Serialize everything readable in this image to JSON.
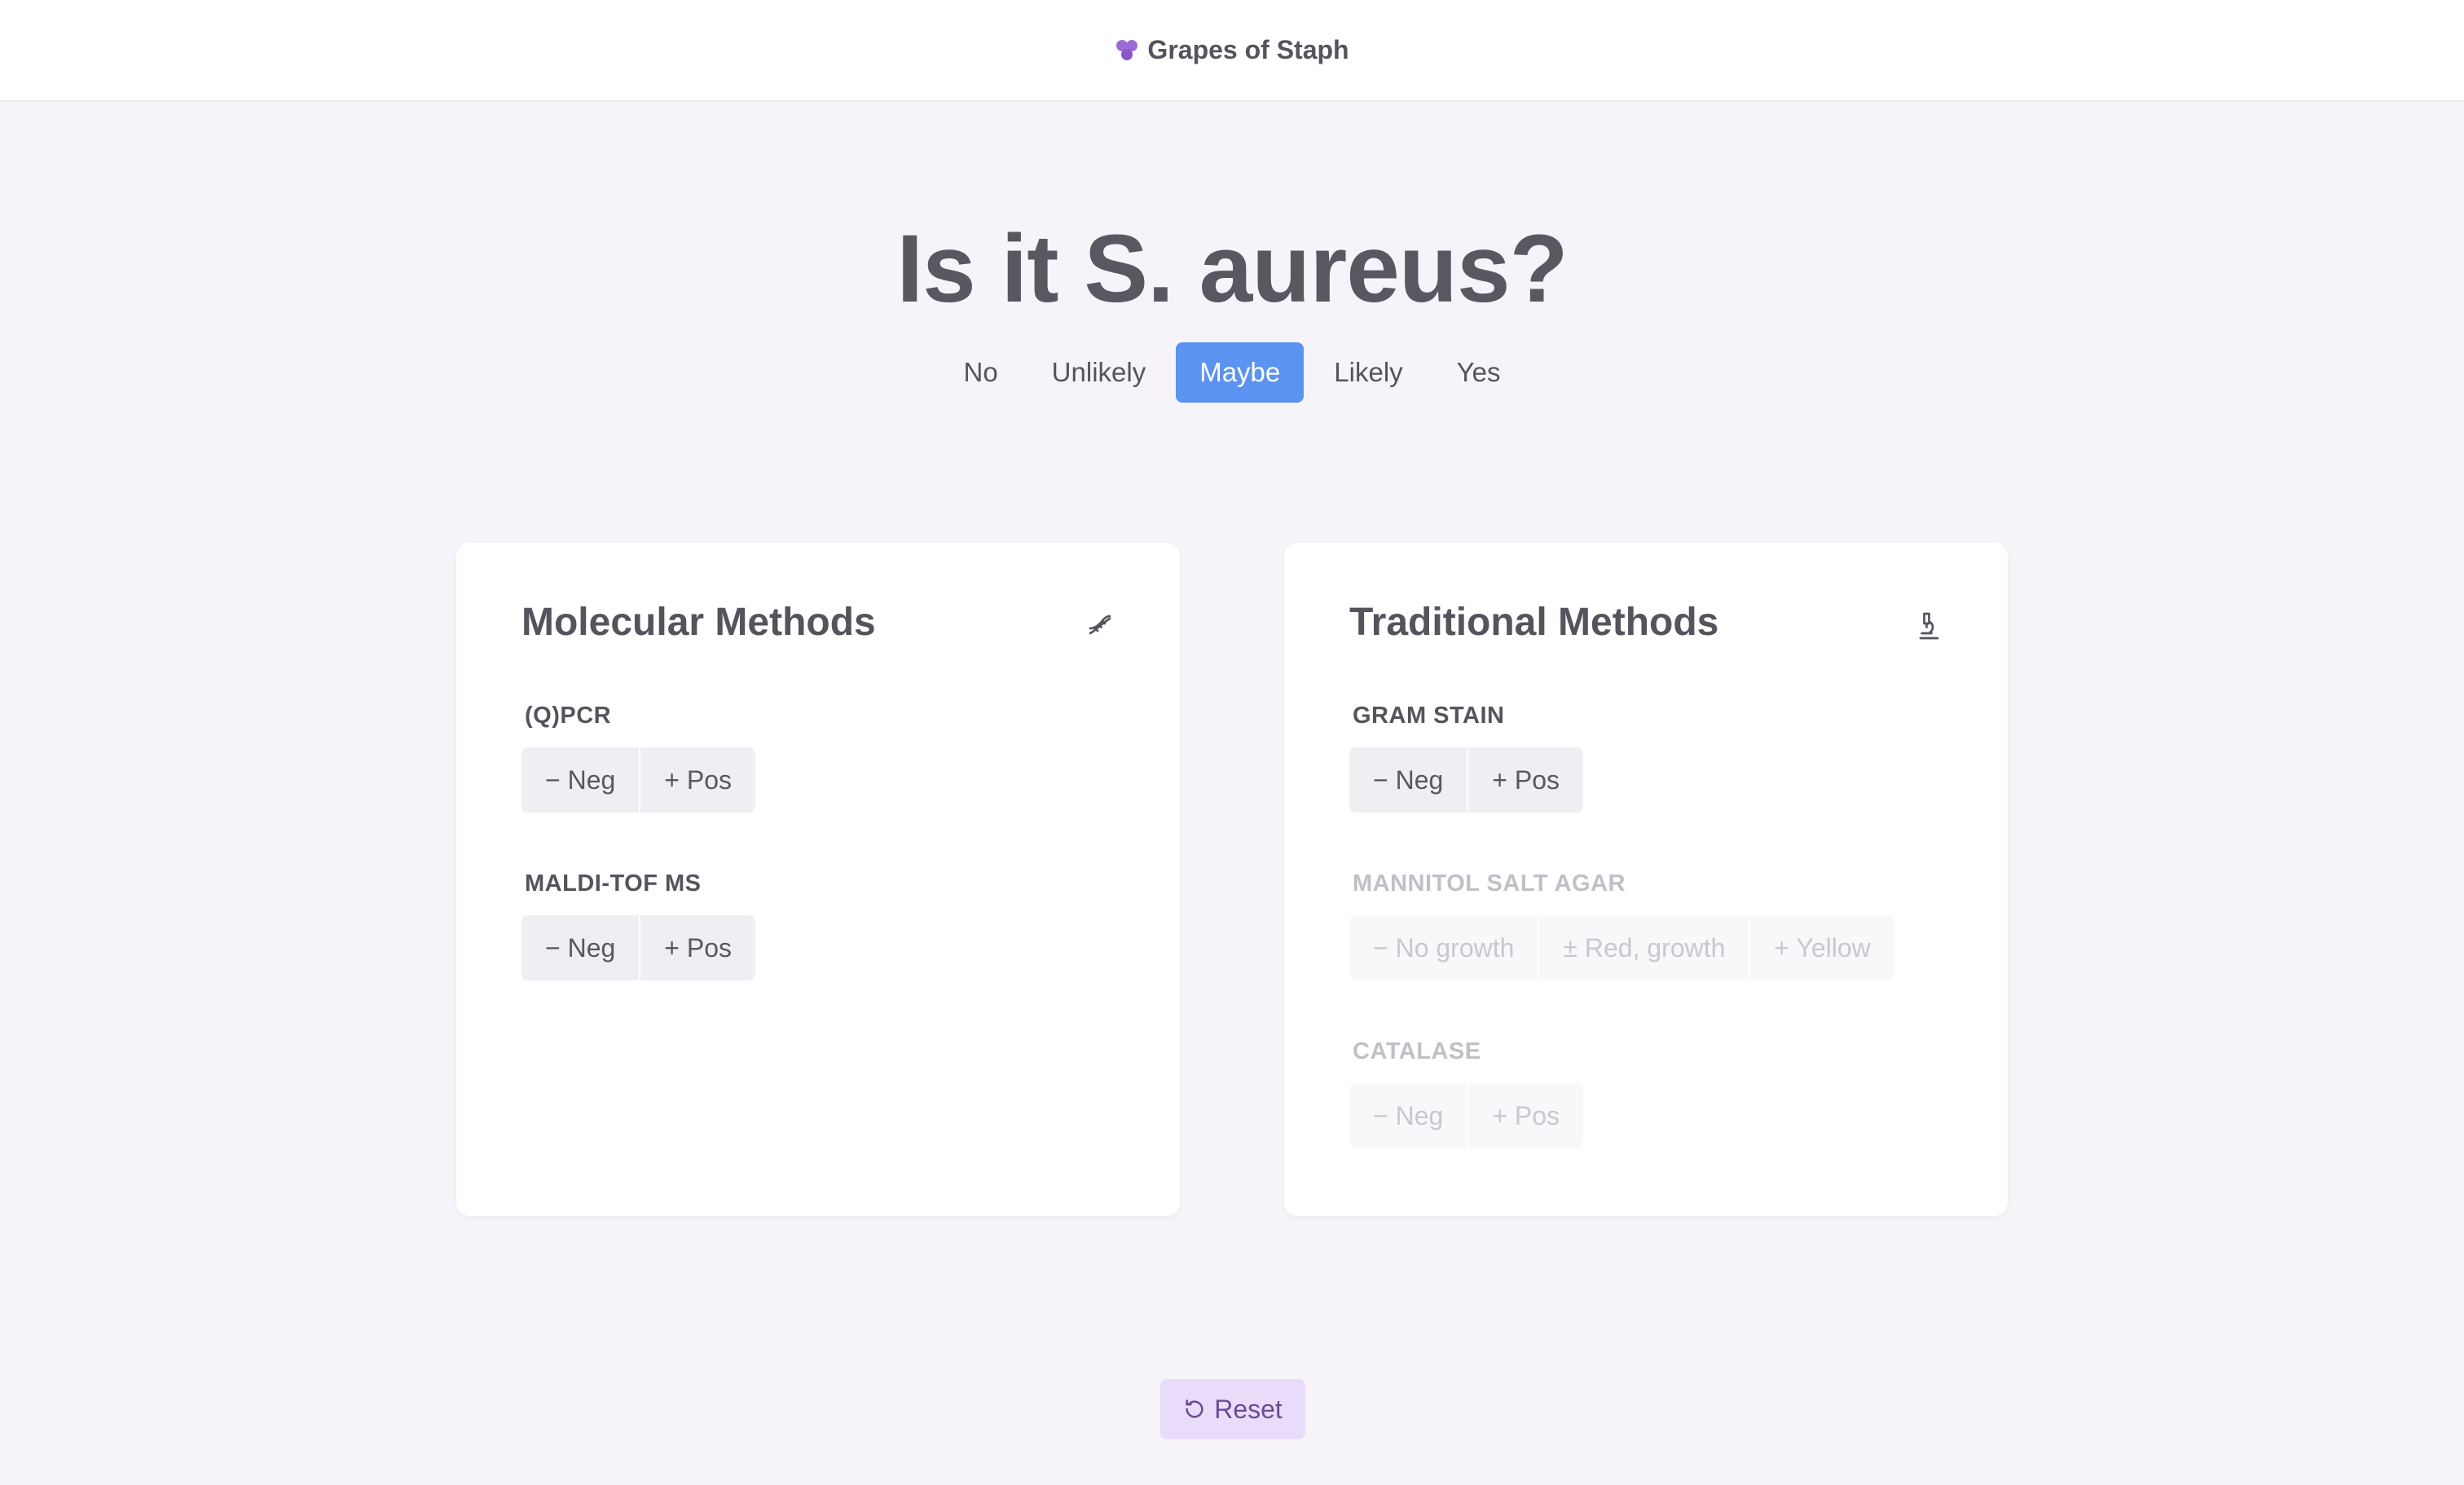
{
  "header": {
    "brand": "Grapes of Staph",
    "logo_icon": "grapes-icon"
  },
  "question": {
    "title": "Is it S. aureus?",
    "options": [
      "No",
      "Unlikely",
      "Maybe",
      "Likely",
      "Yes"
    ],
    "selected": "Maybe",
    "accent": "#5b93f0"
  },
  "molecular": {
    "title": "Molecular Methods",
    "icon": "dna-icon",
    "tests": [
      {
        "label": "(Q)PCR",
        "options": [
          "− Neg",
          "+ Pos"
        ],
        "enabled": true
      },
      {
        "label": "MALDI-TOF MS",
        "options": [
          "− Neg",
          "+ Pos"
        ],
        "enabled": true
      }
    ]
  },
  "traditional": {
    "title": "Traditional Methods",
    "icon": "microscope-icon",
    "tests": [
      {
        "label": "GRAM STAIN",
        "options": [
          "− Neg",
          "+ Pos"
        ],
        "enabled": true
      },
      {
        "label": "MANNITOL SALT AGAR",
        "options": [
          "− No growth",
          "± Red, growth",
          "+ Yellow"
        ],
        "enabled": false
      },
      {
        "label": "CATALASE",
        "options": [
          "− Neg",
          "+ Pos"
        ],
        "enabled": false
      }
    ]
  },
  "reset": {
    "label": "Reset",
    "icon": "reset-icon",
    "color": "#e9dcfb"
  }
}
